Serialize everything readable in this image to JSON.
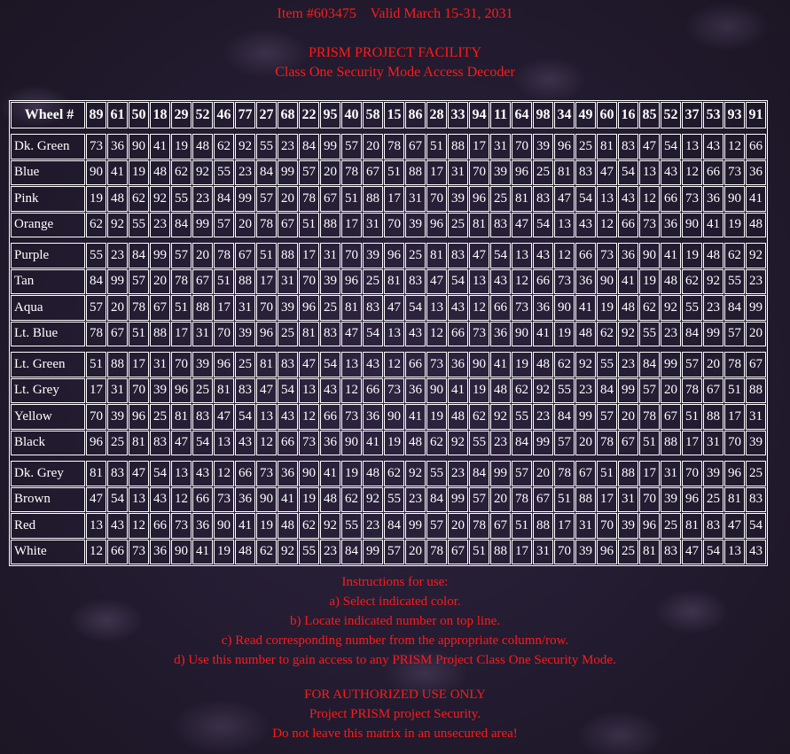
{
  "header": {
    "item_line": "Item #603475    Valid March 15-31, 2031",
    "facility": "PRISM PROJECT FACILITY",
    "decoder": "Class One Security Mode Access Decoder"
  },
  "table": {
    "corner_label": "Wheel #",
    "wheel_numbers": [
      "89",
      "61",
      "50",
      "18",
      "29",
      "52",
      "46",
      "77",
      "27",
      "68",
      "22",
      "95",
      "40",
      "58",
      "15",
      "86",
      "28",
      "33",
      "94",
      "11",
      "64",
      "98",
      "34",
      "49",
      "60",
      "16",
      "85",
      "52",
      "37",
      "53",
      "93",
      "91"
    ],
    "groups": [
      [
        {
          "color": "Dk. Green",
          "values": [
            "73",
            "36",
            "90",
            "41",
            "19",
            "48",
            "62",
            "92",
            "55",
            "23",
            "84",
            "99",
            "57",
            "20",
            "78",
            "67",
            "51",
            "88",
            "17",
            "31",
            "70",
            "39",
            "96",
            "25",
            "81",
            "83",
            "47",
            "54",
            "13",
            "43",
            "12",
            "66"
          ]
        },
        {
          "color": "Blue",
          "values": [
            "90",
            "41",
            "19",
            "48",
            "62",
            "92",
            "55",
            "23",
            "84",
            "99",
            "57",
            "20",
            "78",
            "67",
            "51",
            "88",
            "17",
            "31",
            "70",
            "39",
            "96",
            "25",
            "81",
            "83",
            "47",
            "54",
            "13",
            "43",
            "12",
            "66",
            "73",
            "36"
          ]
        },
        {
          "color": "Pink",
          "values": [
            "19",
            "48",
            "62",
            "92",
            "55",
            "23",
            "84",
            "99",
            "57",
            "20",
            "78",
            "67",
            "51",
            "88",
            "17",
            "31",
            "70",
            "39",
            "96",
            "25",
            "81",
            "83",
            "47",
            "54",
            "13",
            "43",
            "12",
            "66",
            "73",
            "36",
            "90",
            "41"
          ]
        },
        {
          "color": "Orange",
          "values": [
            "62",
            "92",
            "55",
            "23",
            "84",
            "99",
            "57",
            "20",
            "78",
            "67",
            "51",
            "88",
            "17",
            "31",
            "70",
            "39",
            "96",
            "25",
            "81",
            "83",
            "47",
            "54",
            "13",
            "43",
            "12",
            "66",
            "73",
            "36",
            "90",
            "41",
            "19",
            "48"
          ]
        }
      ],
      [
        {
          "color": "Purple",
          "values": [
            "55",
            "23",
            "84",
            "99",
            "57",
            "20",
            "78",
            "67",
            "51",
            "88",
            "17",
            "31",
            "70",
            "39",
            "96",
            "25",
            "81",
            "83",
            "47",
            "54",
            "13",
            "43",
            "12",
            "66",
            "73",
            "36",
            "90",
            "41",
            "19",
            "48",
            "62",
            "92"
          ]
        },
        {
          "color": "Tan",
          "values": [
            "84",
            "99",
            "57",
            "20",
            "78",
            "67",
            "51",
            "88",
            "17",
            "31",
            "70",
            "39",
            "96",
            "25",
            "81",
            "83",
            "47",
            "54",
            "13",
            "43",
            "12",
            "66",
            "73",
            "36",
            "90",
            "41",
            "19",
            "48",
            "62",
            "92",
            "55",
            "23"
          ]
        },
        {
          "color": "Aqua",
          "values": [
            "57",
            "20",
            "78",
            "67",
            "51",
            "88",
            "17",
            "31",
            "70",
            "39",
            "96",
            "25",
            "81",
            "83",
            "47",
            "54",
            "13",
            "43",
            "12",
            "66",
            "73",
            "36",
            "90",
            "41",
            "19",
            "48",
            "62",
            "92",
            "55",
            "23",
            "84",
            "99"
          ]
        },
        {
          "color": "Lt. Blue",
          "values": [
            "78",
            "67",
            "51",
            "88",
            "17",
            "31",
            "70",
            "39",
            "96",
            "25",
            "81",
            "83",
            "47",
            "54",
            "13",
            "43",
            "12",
            "66",
            "73",
            "36",
            "90",
            "41",
            "19",
            "48",
            "62",
            "92",
            "55",
            "23",
            "84",
            "99",
            "57",
            "20"
          ]
        }
      ],
      [
        {
          "color": "Lt. Green",
          "values": [
            "51",
            "88",
            "17",
            "31",
            "70",
            "39",
            "96",
            "25",
            "81",
            "83",
            "47",
            "54",
            "13",
            "43",
            "12",
            "66",
            "73",
            "36",
            "90",
            "41",
            "19",
            "48",
            "62",
            "92",
            "55",
            "23",
            "84",
            "99",
            "57",
            "20",
            "78",
            "67"
          ]
        },
        {
          "color": "Lt. Grey",
          "values": [
            "17",
            "31",
            "70",
            "39",
            "96",
            "25",
            "81",
            "83",
            "47",
            "54",
            "13",
            "43",
            "12",
            "66",
            "73",
            "36",
            "90",
            "41",
            "19",
            "48",
            "62",
            "92",
            "55",
            "23",
            "84",
            "99",
            "57",
            "20",
            "78",
            "67",
            "51",
            "88"
          ]
        },
        {
          "color": "Yellow",
          "values": [
            "70",
            "39",
            "96",
            "25",
            "81",
            "83",
            "47",
            "54",
            "13",
            "43",
            "12",
            "66",
            "73",
            "36",
            "90",
            "41",
            "19",
            "48",
            "62",
            "92",
            "55",
            "23",
            "84",
            "99",
            "57",
            "20",
            "78",
            "67",
            "51",
            "88",
            "17",
            "31"
          ]
        },
        {
          "color": "Black",
          "values": [
            "96",
            "25",
            "81",
            "83",
            "47",
            "54",
            "13",
            "43",
            "12",
            "66",
            "73",
            "36",
            "90",
            "41",
            "19",
            "48",
            "62",
            "92",
            "55",
            "23",
            "84",
            "99",
            "57",
            "20",
            "78",
            "67",
            "51",
            "88",
            "17",
            "31",
            "70",
            "39"
          ]
        }
      ],
      [
        {
          "color": "Dk. Grey",
          "values": [
            "81",
            "83",
            "47",
            "54",
            "13",
            "43",
            "12",
            "66",
            "73",
            "36",
            "90",
            "41",
            "19",
            "48",
            "62",
            "92",
            "55",
            "23",
            "84",
            "99",
            "57",
            "20",
            "78",
            "67",
            "51",
            "88",
            "17",
            "31",
            "70",
            "39",
            "96",
            "25"
          ]
        },
        {
          "color": "Brown",
          "values": [
            "47",
            "54",
            "13",
            "43",
            "12",
            "66",
            "73",
            "36",
            "90",
            "41",
            "19",
            "48",
            "62",
            "92",
            "55",
            "23",
            "84",
            "99",
            "57",
            "20",
            "78",
            "67",
            "51",
            "88",
            "17",
            "31",
            "70",
            "39",
            "96",
            "25",
            "81",
            "83"
          ]
        },
        {
          "color": "Red",
          "values": [
            "13",
            "43",
            "12",
            "66",
            "73",
            "36",
            "90",
            "41",
            "19",
            "48",
            "62",
            "92",
            "55",
            "23",
            "84",
            "99",
            "57",
            "20",
            "78",
            "67",
            "51",
            "88",
            "17",
            "31",
            "70",
            "39",
            "96",
            "25",
            "81",
            "83",
            "47",
            "54"
          ]
        },
        {
          "color": "White",
          "values": [
            "12",
            "66",
            "73",
            "36",
            "90",
            "41",
            "19",
            "48",
            "62",
            "92",
            "55",
            "23",
            "84",
            "99",
            "57",
            "20",
            "78",
            "67",
            "51",
            "88",
            "17",
            "31",
            "70",
            "39",
            "96",
            "25",
            "81",
            "83",
            "47",
            "54",
            "13",
            "43"
          ]
        }
      ]
    ]
  },
  "instructions": [
    "Instructions for use:",
    "a) Select indicated color.",
    "b) Locate indicated number on top line.",
    "c) Read corresponding number from the appropriate column/row.",
    "d) Use this number to gain access to any PRISM Project Class One Security Mode."
  ],
  "warning": [
    "FOR AUTHORIZED USE ONLY",
    "Project PRISM project Security.",
    "Do not leave this matrix in an unsecured area!"
  ],
  "colors": {
    "text_red": "#ff1a1a",
    "table_text": "#ffffff",
    "background": "#241c30"
  }
}
